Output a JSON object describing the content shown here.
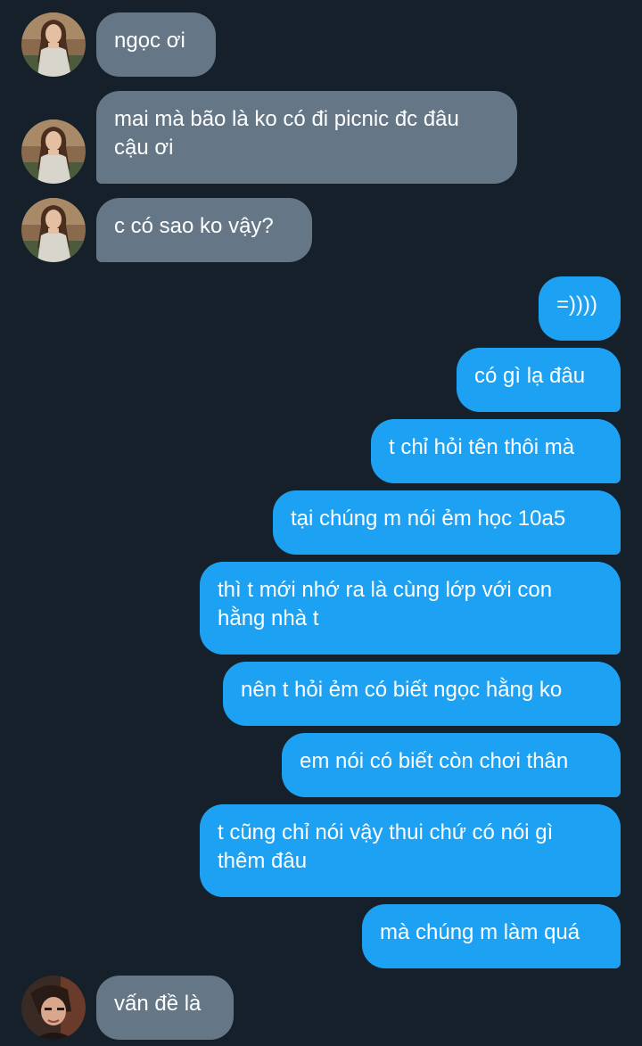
{
  "conversation": {
    "messages": [
      {
        "direction": "incoming",
        "text": "ngọc ơi",
        "avatar": "avatar-woman"
      },
      {
        "direction": "incoming",
        "text": "mai mà bão là ko có đi picnic đc đâu cậu ơi",
        "avatar": "avatar-woman"
      },
      {
        "direction": "incoming",
        "text": "c có sao ko vậy?",
        "avatar": "avatar-woman"
      },
      {
        "direction": "outgoing",
        "text": "=))))"
      },
      {
        "direction": "outgoing",
        "text": "có gì lạ đâu"
      },
      {
        "direction": "outgoing",
        "text": "t chỉ hỏi tên thôi mà"
      },
      {
        "direction": "outgoing",
        "text": "tại chúng m nói ẻm học 10a5"
      },
      {
        "direction": "outgoing",
        "text": "thì t mới nhớ ra là cùng lớp với con hằng nhà t"
      },
      {
        "direction": "outgoing",
        "text": "nên t hỏi ẻm có biết ngọc hằng ko"
      },
      {
        "direction": "outgoing",
        "text": "em nói có biết còn chơi thân"
      },
      {
        "direction": "outgoing",
        "text": "t cũng chỉ nói vậy thui chứ có nói gì thêm đâu"
      },
      {
        "direction": "outgoing",
        "text": "mà chúng m làm quá"
      },
      {
        "direction": "incoming",
        "text": "vấn đề là",
        "avatar": "avatar-person"
      }
    ]
  },
  "theme": {
    "background": "#15202b",
    "incoming_bubble": "#657786",
    "outgoing_bubble": "#1da1f2",
    "text": "#ffffff"
  }
}
